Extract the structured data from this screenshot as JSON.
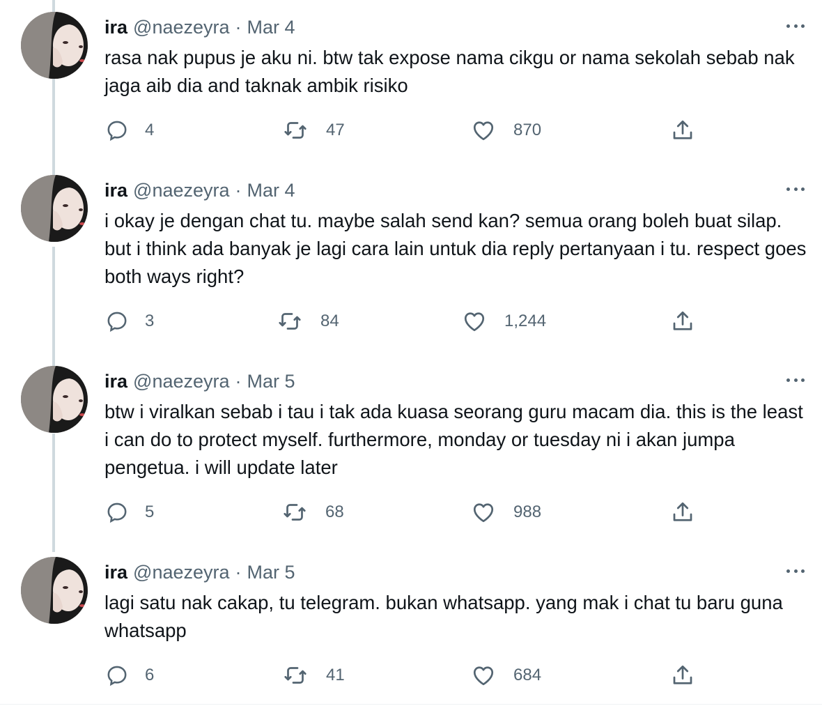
{
  "tweets": [
    {
      "name": "ira",
      "handle": "@naezeyra",
      "separator": "·",
      "date": "Mar 4",
      "text": "rasa nak pupus je aku ni. btw tak expose nama cikgu or nama sekolah sebab nak jaga aib dia and taknak ambik risiko",
      "replies": "4",
      "retweets": "47",
      "likes": "870"
    },
    {
      "name": "ira",
      "handle": "@naezeyra",
      "separator": "·",
      "date": "Mar 4",
      "text": "i okay je dengan chat tu. maybe salah send kan? semua orang boleh buat silap. but i think ada banyak je lagi cara lain untuk dia reply pertanyaan i tu. respect goes both ways right?",
      "replies": "3",
      "retweets": "84",
      "likes": "1,244"
    },
    {
      "name": "ira",
      "handle": "@naezeyra",
      "separator": "·",
      "date": "Mar 5",
      "text": "btw i viralkan sebab i tau i tak ada kuasa seorang guru macam dia. this is the least i can do to protect myself. furthermore, monday or tuesday ni i akan jumpa pengetua. i will update later",
      "replies": "5",
      "retweets": "68",
      "likes": "988"
    },
    {
      "name": "ira",
      "handle": "@naezeyra",
      "separator": "·",
      "date": "Mar 5",
      "text": "lagi satu nak cakap, tu telegram. bukan whatsapp. yang mak i chat tu baru guna whatsapp",
      "replies": "6",
      "retweets": "41",
      "likes": "684"
    }
  ],
  "icons": {
    "reply": "reply-icon",
    "retweet": "retweet-icon",
    "like": "heart-icon",
    "share": "share-icon",
    "more": "more-icon"
  },
  "colors": {
    "text": "#0f1419",
    "secondary": "#536471",
    "thread_line": "#cfd9de"
  }
}
